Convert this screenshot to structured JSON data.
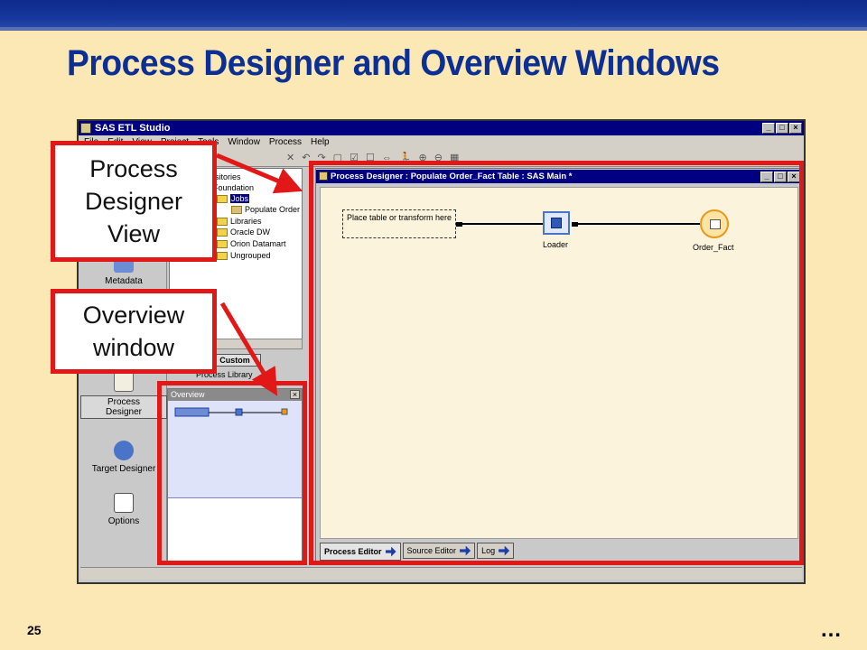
{
  "slide": {
    "title": "Process Designer and Overview Windows",
    "number": "25",
    "more": "…"
  },
  "app": {
    "title": "SAS ETL Studio",
    "menu": [
      "File",
      "Edit",
      "View",
      "Project",
      "Tools",
      "Window",
      "Process",
      "Help"
    ],
    "shortcuts": [
      "Metadata",
      "Process Designer",
      "Target Designer",
      "Options"
    ],
    "tree": [
      "positories",
      "Foundation",
      "Jobs",
      "Populate Order",
      "Libraries",
      "Oracle DW",
      "Orion Datamart",
      "Ungrouped"
    ],
    "tabs": {
      "custom": "Custom",
      "process_library": "Process Library"
    },
    "overview_title": "Overview"
  },
  "designer": {
    "title": "Process Designer : Populate Order_Fact Table : SAS Main *",
    "placeholder": "Place table or transform here",
    "node_loader": "Loader",
    "node_target": "Order_Fact",
    "tabs": [
      "Process Editor",
      "Source Editor",
      "Log"
    ]
  },
  "callouts": {
    "designer_view": "Process Designer View",
    "overview_window": "Overview window"
  },
  "colors": {
    "callout_red": "#e21818",
    "title_blue": "#0c2f94",
    "background": "#fbe8b5"
  }
}
